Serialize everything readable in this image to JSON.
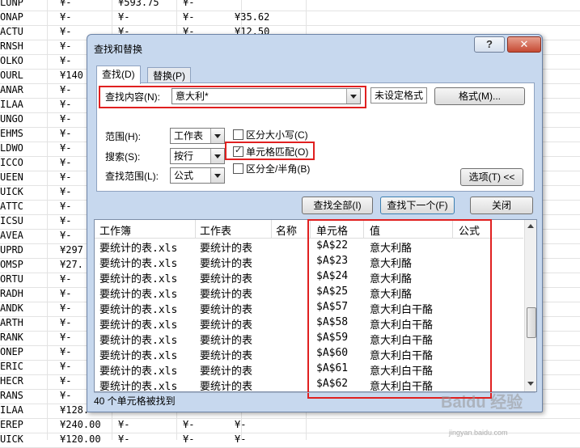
{
  "sheet": {
    "rows": [
      {
        "code": "LUNP",
        "b": "¥-",
        "c": "¥593.75",
        "d": "¥-",
        "e": ""
      },
      {
        "code": "ONAP",
        "b": "¥-",
        "c": "¥-",
        "d": "¥-",
        "e": "¥35.62"
      },
      {
        "code": "ACTU",
        "b": "¥-",
        "c": "¥-",
        "d": "¥-",
        "e": "¥12.50"
      },
      {
        "code": "RNSH",
        "b": "¥-",
        "c": "",
        "d": "",
        "e": ""
      },
      {
        "code": "OLKO",
        "b": "¥-",
        "c": "",
        "d": "",
        "e": ""
      },
      {
        "code": "OURL",
        "b": "¥140",
        "c": "",
        "d": "",
        "e": ""
      },
      {
        "code": "ANAR",
        "b": "¥-",
        "c": "",
        "d": "",
        "e": ""
      },
      {
        "code": "ILAA",
        "b": "¥-",
        "c": "",
        "d": "",
        "e": ""
      },
      {
        "code": "UNGO",
        "b": "¥-",
        "c": "",
        "d": "",
        "e": ""
      },
      {
        "code": "EHMS",
        "b": "¥-",
        "c": "",
        "d": "",
        "e": ""
      },
      {
        "code": "LDWO",
        "b": "¥-",
        "c": "",
        "d": "",
        "e": ""
      },
      {
        "code": "ICCO",
        "b": "¥-",
        "c": "",
        "d": "",
        "e": ""
      },
      {
        "code": "UEEN",
        "b": "¥-",
        "c": "",
        "d": "",
        "e": ""
      },
      {
        "code": "UICK",
        "b": "¥-",
        "c": "",
        "d": "",
        "e": ""
      },
      {
        "code": "ATTC",
        "b": "¥-",
        "c": "",
        "d": "",
        "e": ""
      },
      {
        "code": "ICSU",
        "b": "¥-",
        "c": "",
        "d": "",
        "e": ""
      },
      {
        "code": "AVEA",
        "b": "¥-",
        "c": "",
        "d": "",
        "e": ""
      },
      {
        "code": "UPRD",
        "b": "¥297",
        "c": "",
        "d": "",
        "e": ""
      },
      {
        "code": "OMSP",
        "b": "¥27.",
        "c": "",
        "d": "",
        "e": ""
      },
      {
        "code": "ORTU",
        "b": "¥-",
        "c": "",
        "d": "",
        "e": ""
      },
      {
        "code": "RADH",
        "b": "¥-",
        "c": "",
        "d": "",
        "e": ""
      },
      {
        "code": "ANDK",
        "b": "¥-",
        "c": "",
        "d": "",
        "e": ""
      },
      {
        "code": "ARTH",
        "b": "¥-",
        "c": "",
        "d": "",
        "e": ""
      },
      {
        "code": "RANK",
        "b": "¥-",
        "c": "",
        "d": "",
        "e": ""
      },
      {
        "code": "ONEP",
        "b": "¥-",
        "c": "",
        "d": "",
        "e": ""
      },
      {
        "code": "ERIC",
        "b": "¥-",
        "c": "",
        "d": "",
        "e": ""
      },
      {
        "code": "HECR",
        "b": "¥-",
        "c": "",
        "d": "",
        "e": ""
      },
      {
        "code": "RANS",
        "b": "¥-",
        "c": "",
        "d": "",
        "e": ""
      },
      {
        "code": "ILAA",
        "b": "¥128.",
        "c": "",
        "d": "",
        "e": ""
      },
      {
        "code": "EREP",
        "b": "¥240.00",
        "c": "¥-",
        "d": "¥-",
        "e": "¥-"
      },
      {
        "code": "UICK",
        "b": "¥120.00",
        "c": "¥-",
        "d": "¥-",
        "e": "¥-"
      }
    ]
  },
  "dialog": {
    "title": "查找和替换",
    "help_glyph": "?",
    "close_glyph": "✕",
    "tabs": {
      "find": "查找(D)",
      "replace": "替换(P)"
    },
    "find_label": "查找内容(N):",
    "find_value": "意大利*",
    "format_preview": "未设定格式",
    "format_button": "格式(M)...",
    "scope_label": "范围(H):",
    "scope_value": "工作表",
    "search_label": "搜索(S):",
    "search_value": "按行",
    "lookin_label": "查找范围(L):",
    "lookin_value": "公式",
    "match_case": "区分大小写(C)",
    "match_entire": "单元格匹配(O)",
    "match_width": "区分全/半角(B)",
    "options_button": "选项(T) <<",
    "find_all_button": "查找全部(I)",
    "find_next_button": "查找下一个(F)",
    "close_button": "关闭",
    "status": "40 个单元格被找到"
  },
  "results": {
    "columns": [
      "工作簿",
      "工作表",
      "名称",
      "单元格",
      "值",
      "公式"
    ],
    "rows": [
      {
        "book": "要统计的表.xls",
        "sheet": "要统计的表",
        "name": "",
        "cell": "$A$22",
        "value": "意大利酪"
      },
      {
        "book": "要统计的表.xls",
        "sheet": "要统计的表",
        "name": "",
        "cell": "$A$23",
        "value": "意大利酪"
      },
      {
        "book": "要统计的表.xls",
        "sheet": "要统计的表",
        "name": "",
        "cell": "$A$24",
        "value": "意大利酪"
      },
      {
        "book": "要统计的表.xls",
        "sheet": "要统计的表",
        "name": "",
        "cell": "$A$25",
        "value": "意大利酪"
      },
      {
        "book": "要统计的表.xls",
        "sheet": "要统计的表",
        "name": "",
        "cell": "$A$57",
        "value": "意大利白干酪"
      },
      {
        "book": "要统计的表.xls",
        "sheet": "要统计的表",
        "name": "",
        "cell": "$A$58",
        "value": "意大利白干酪"
      },
      {
        "book": "要统计的表.xls",
        "sheet": "要统计的表",
        "name": "",
        "cell": "$A$59",
        "value": "意大利白干酪"
      },
      {
        "book": "要统计的表.xls",
        "sheet": "要统计的表",
        "name": "",
        "cell": "$A$60",
        "value": "意大利白干酪"
      },
      {
        "book": "要统计的表.xls",
        "sheet": "要统计的表",
        "name": "",
        "cell": "$A$61",
        "value": "意大利白干酪"
      },
      {
        "book": "要统计的表.xls",
        "sheet": "要统计的表",
        "name": "",
        "cell": "$A$62",
        "value": "意大利白干酪"
      }
    ]
  },
  "watermark": {
    "main": "Baidu 经验",
    "sub": "jingyan.baidu.com"
  },
  "colors": {
    "highlight": "#e02020",
    "dialog_bg": "#c7d8ee"
  }
}
